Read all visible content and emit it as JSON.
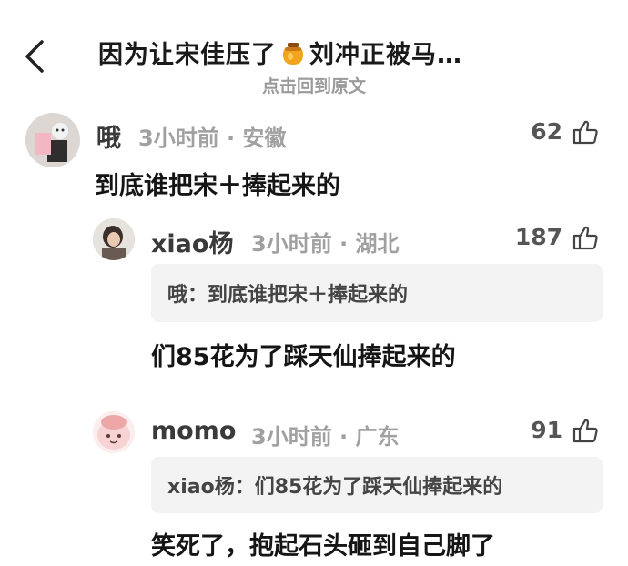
{
  "header": {
    "title_prefix": "因为让宋佳压了",
    "title_suffix": "刘冲正被马…",
    "emoji_icon": "honey-jar-icon",
    "subtitle": "点击回到原文"
  },
  "comments": [
    {
      "name": "哦",
      "meta": "3小时前 · 安徽",
      "likes": "62",
      "text": "到底谁把宋＋捧起来的"
    },
    {
      "name": "xiao杨",
      "meta": "3小时前 · 湖北",
      "likes": "187",
      "quote": "哦：到底谁把宋＋捧起来的",
      "text": "们85花为了踩天仙捧起来的"
    },
    {
      "name": "momo",
      "meta": "3小时前 · 广东",
      "likes": "91",
      "quote": "xiao杨：们85花为了踩天仙捧起来的",
      "text": "笑死了，抱起石头砸到自己脚了"
    }
  ],
  "colors": {
    "quote_bg": "#f3f3f3",
    "meta_gray": "#a0a0a0",
    "text": "#151515"
  }
}
